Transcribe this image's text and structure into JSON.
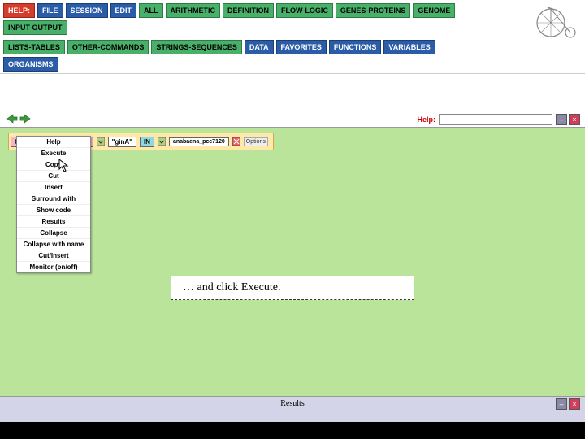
{
  "toolbar": {
    "row1": [
      {
        "label": "HELP:",
        "cls": "btn-red"
      },
      {
        "label": "FILE",
        "cls": "btn-blue"
      },
      {
        "label": "SESSION",
        "cls": "btn-blue"
      },
      {
        "label": "EDIT",
        "cls": "btn-blue"
      },
      {
        "label": "ALL",
        "cls": "btn-green"
      },
      {
        "label": "ARITHMETIC",
        "cls": "btn-green"
      },
      {
        "label": "DEFINITION",
        "cls": "btn-green"
      },
      {
        "label": "FLOW-LOGIC",
        "cls": "btn-green"
      },
      {
        "label": "GENES-PROTEINS",
        "cls": "btn-green"
      },
      {
        "label": "GENOME",
        "cls": "btn-green"
      },
      {
        "label": "INPUT-OUTPUT",
        "cls": "btn-green"
      }
    ],
    "row2": [
      {
        "label": "LISTS-TABLES",
        "cls": "btn-green"
      },
      {
        "label": "OTHER-COMMANDS",
        "cls": "btn-green"
      },
      {
        "label": "STRINGS-SEQUENCES",
        "cls": "btn-green"
      },
      {
        "label": "DATA",
        "cls": "btn-blue"
      },
      {
        "label": "FAVORITES",
        "cls": "btn-blue"
      },
      {
        "label": "FUNCTIONS",
        "cls": "btn-blue"
      },
      {
        "label": "VARIABLES",
        "cls": "btn-blue"
      },
      {
        "label": "ORGANISMS",
        "cls": "btn-blue"
      }
    ]
  },
  "help": {
    "label": "Help:",
    "value": ""
  },
  "expression": {
    "head": "GENES-DESCRIBED-BY",
    "arg1": "\"ginA\"",
    "in_kw": "IN",
    "arg2": "anabaena_pcc7120",
    "options": "Options"
  },
  "context_menu": [
    "Help",
    "Execute",
    "Copy",
    "Cut",
    "Insert",
    "Surround with",
    "Show code",
    "Results",
    "Collapse",
    "Collapse with name",
    "Cut/Insert",
    "Monitor (on/off)"
  ],
  "callout": "… and click Execute.",
  "results": {
    "title": "Results"
  }
}
